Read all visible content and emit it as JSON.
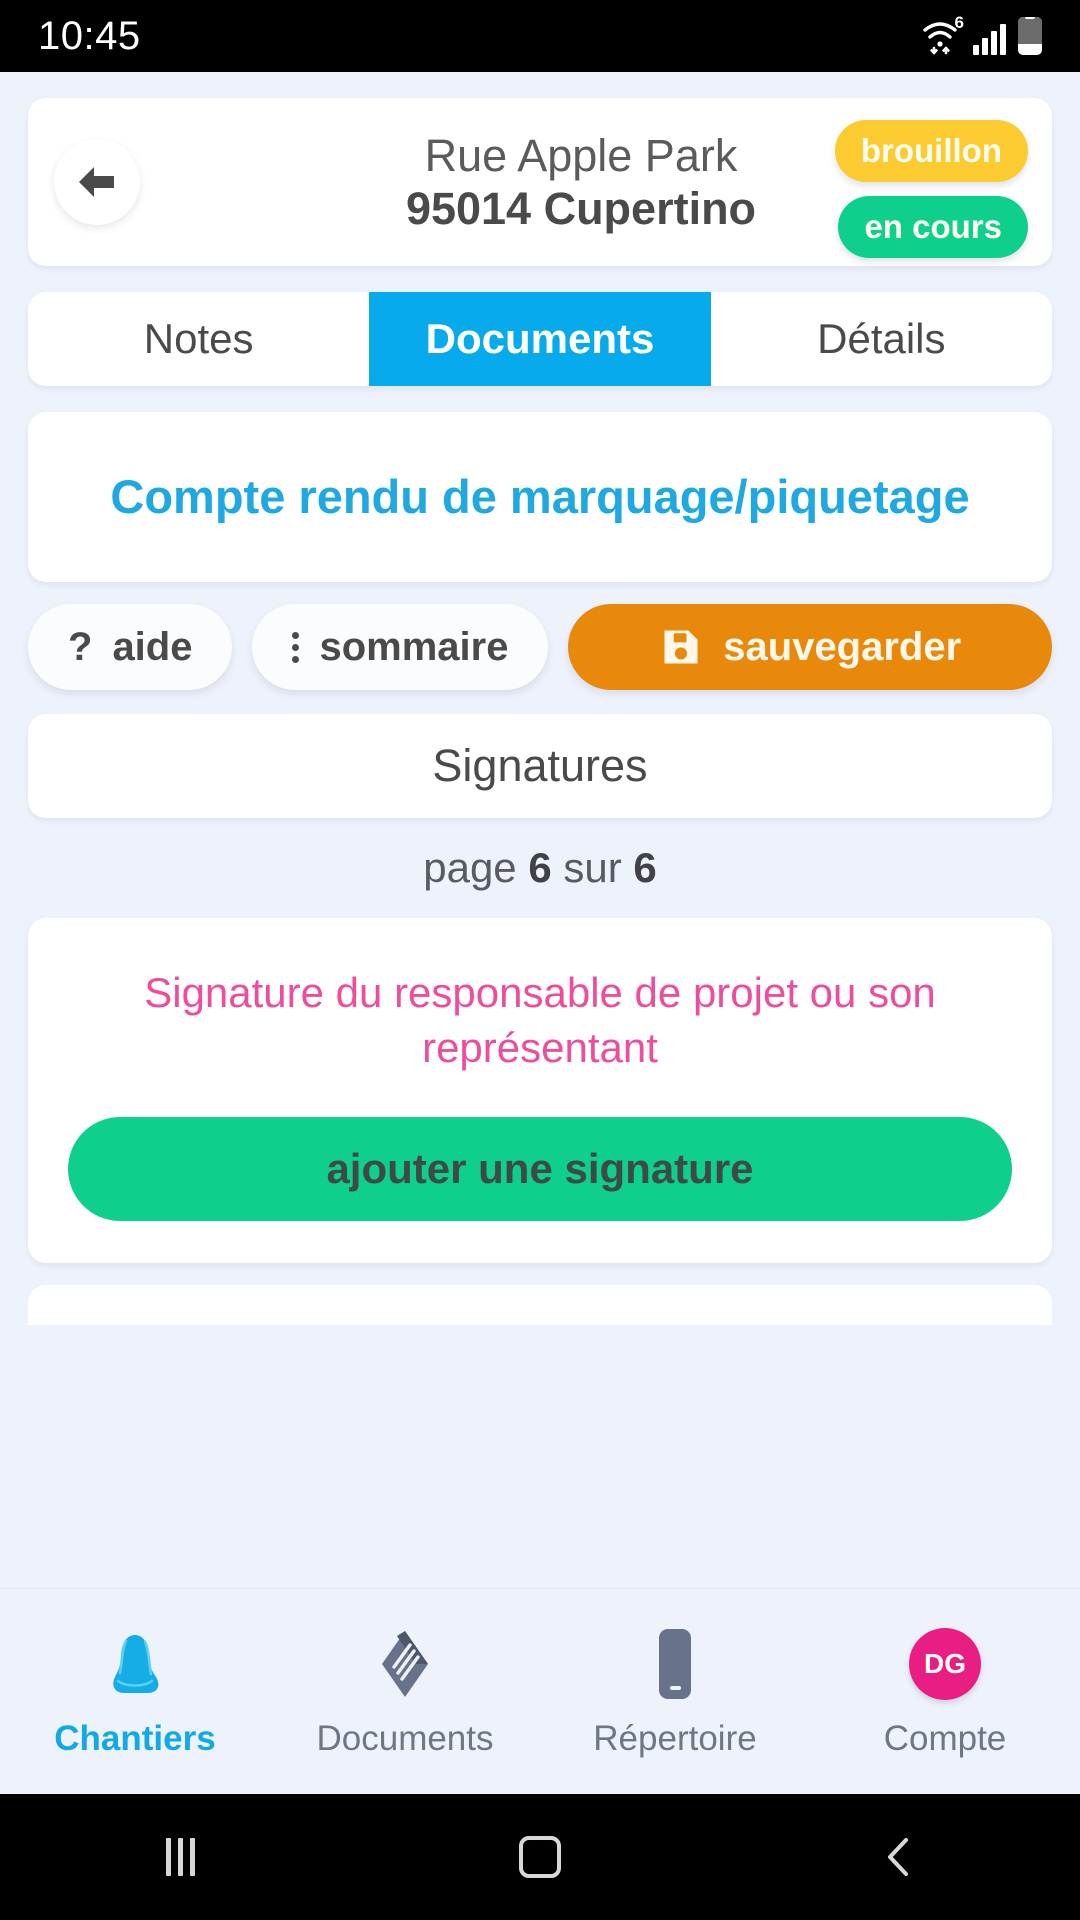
{
  "statusbar": {
    "time": "10:45",
    "wifi_generation": "6",
    "icons": [
      "wifi-icon",
      "signal-icon",
      "battery-icon"
    ]
  },
  "header": {
    "back_icon": "back-arrow-icon",
    "address_line1": "Rue Apple Park",
    "address_line2": "95014 Cupertino",
    "badges": [
      {
        "label": "brouillon",
        "color": "#fbcb2f"
      },
      {
        "label": "en cours",
        "color": "#0ed08c"
      }
    ]
  },
  "tabs": {
    "items": [
      {
        "label": "Notes",
        "active": false
      },
      {
        "label": "Documents",
        "active": true
      },
      {
        "label": "Détails",
        "active": false
      }
    ],
    "active_color": "#07abeb"
  },
  "document": {
    "title": "Compte rendu de marquage/piquetage",
    "title_color": "#1fa9e0"
  },
  "actions": {
    "help_label": "aide",
    "help_icon": "question-mark-icon",
    "summary_label": "sommaire",
    "summary_icon": "kebab-menu-icon",
    "save_label": "sauvegarder",
    "save_icon": "floppy-disk-save-icon",
    "save_color": "#e8890c"
  },
  "section": {
    "signatures_header": "Signatures",
    "page_prefix": "page",
    "page_current": "6",
    "page_middle": "sur",
    "page_total": "6"
  },
  "signature_block": {
    "label": "Signature du responsable de projet ou son représentant",
    "label_color": "#ed4e9b",
    "button_label": "ajouter une signature",
    "button_color": "#0ed08c"
  },
  "bottomnav": {
    "items": [
      {
        "label": "Chantiers",
        "icon": "hard-hat-icon",
        "active": true
      },
      {
        "label": "Documents",
        "icon": "documents-icon",
        "active": false
      },
      {
        "label": "Répertoire",
        "icon": "phone-icon",
        "active": false
      },
      {
        "label": "Compte",
        "icon": "avatar-icon",
        "active": false,
        "initials": "DG"
      }
    ],
    "active_color": "#12a9e8",
    "avatar_color": "#e91e82"
  },
  "androidnav": {
    "recents": "recents-icon",
    "home": "home-icon",
    "back": "back-icon"
  }
}
